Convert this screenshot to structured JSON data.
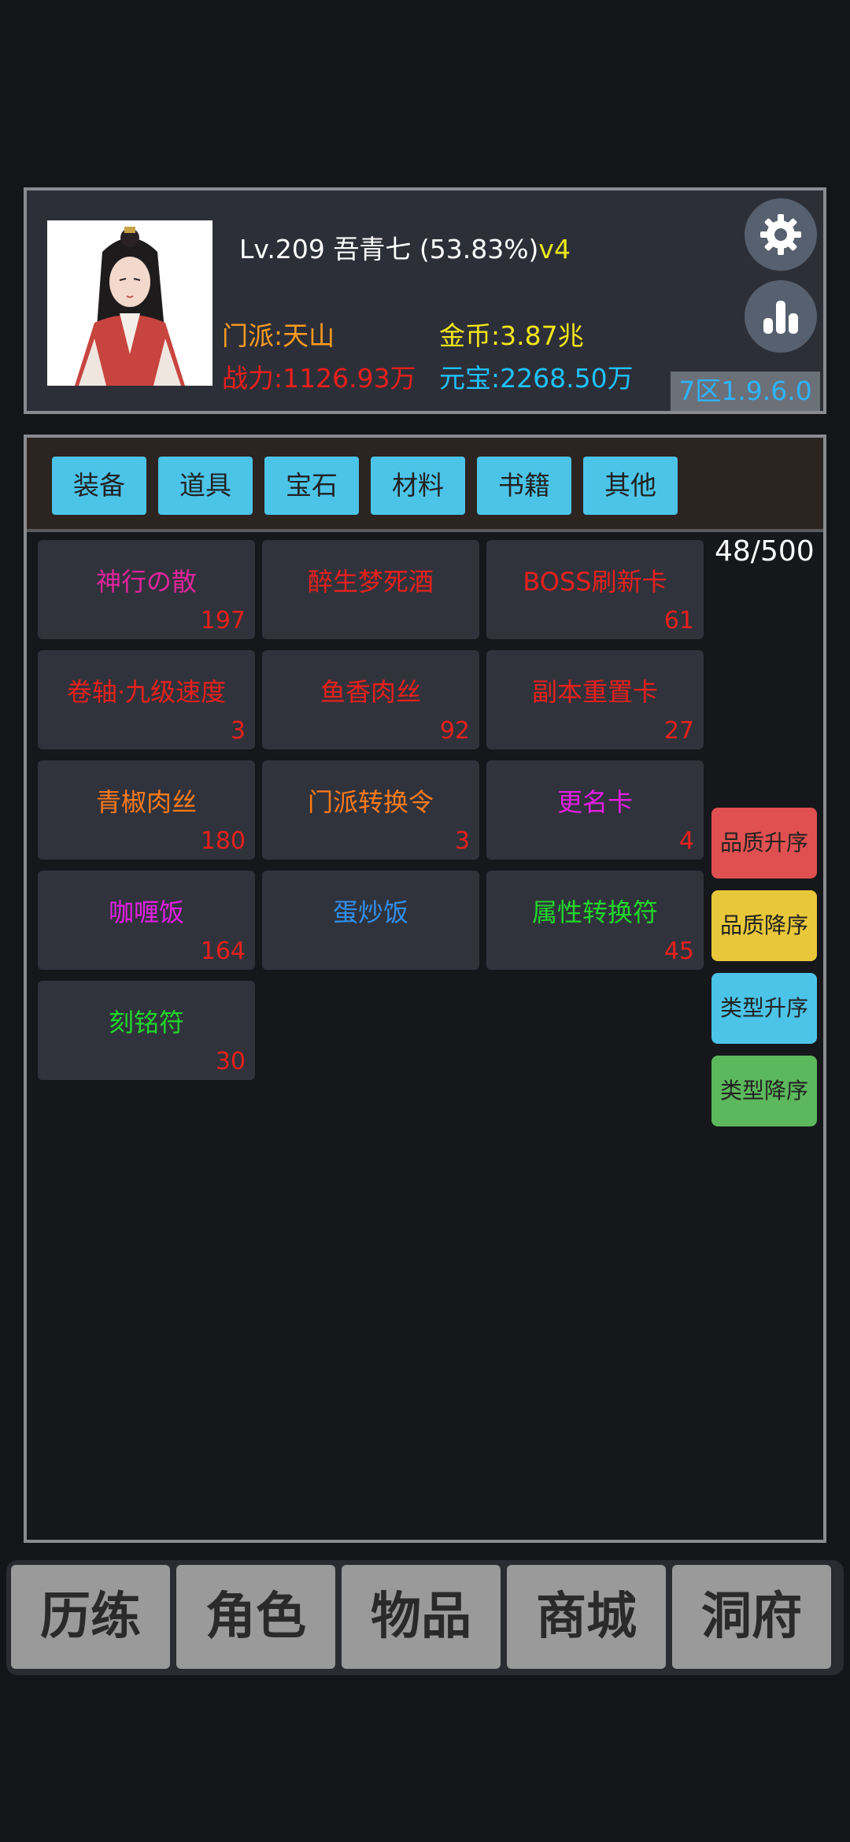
{
  "player": {
    "level": "Lv.209",
    "name": "吾青七",
    "progress": "(53.83%)",
    "vip": "v4",
    "sect": "门派:天山",
    "gold": "金币:3.87兆",
    "power": "战力:1126.93万",
    "yuanbao": "元宝:2268.50万",
    "server": "7区1.9.6.0"
  },
  "tabs": [
    "装备",
    "道具",
    "宝石",
    "材料",
    "书籍",
    "其他"
  ],
  "inventory": {
    "count": "48/500",
    "items": [
      {
        "name": "神行の散",
        "qty": "197",
        "color": "#e0249b"
      },
      {
        "name": "醉生梦死酒",
        "qty": "",
        "color": "#e8201c"
      },
      {
        "name": "BOSS刷新卡",
        "qty": "61",
        "color": "#e8201c"
      },
      {
        "name": "卷轴·九级速度",
        "qty": "3",
        "color": "#e8201c"
      },
      {
        "name": "鱼香肉丝",
        "qty": "92",
        "color": "#e8201c"
      },
      {
        "name": "副本重置卡",
        "qty": "27",
        "color": "#e8201c"
      },
      {
        "name": "青椒肉丝",
        "qty": "180",
        "color": "#ff7a1a"
      },
      {
        "name": "门派转换令",
        "qty": "3",
        "color": "#ff7a1a"
      },
      {
        "name": "更名卡",
        "qty": "4",
        "color": "#e61ee6"
      },
      {
        "name": "咖喱饭",
        "qty": "164",
        "color": "#e61ee6"
      },
      {
        "name": "蛋炒饭",
        "qty": "",
        "color": "#2f8ff0"
      },
      {
        "name": "属性转换符",
        "qty": "45",
        "color": "#20d82a"
      },
      {
        "name": "刻铭符",
        "qty": "30",
        "color": "#20d82a"
      }
    ]
  },
  "sort_buttons": [
    {
      "label": "品质升序",
      "color": "#e05050"
    },
    {
      "label": "品质降序",
      "color": "#e8c83a"
    },
    {
      "label": "类型升序",
      "color": "#4cc4e8"
    },
    {
      "label": "类型降序",
      "color": "#5cb85c"
    }
  ],
  "nav": [
    "历练",
    "角色",
    "物品",
    "商城",
    "洞府"
  ],
  "icons": {
    "settings": "gear-icon",
    "stats": "bar-chart-icon"
  }
}
